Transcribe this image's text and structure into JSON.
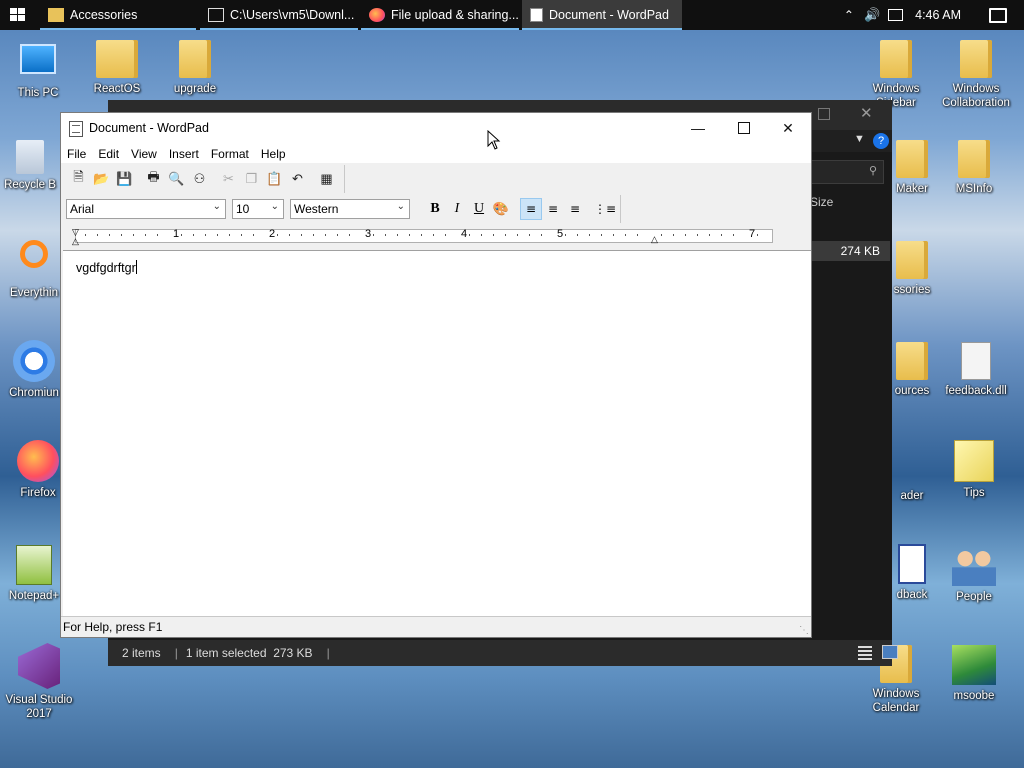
{
  "taskbar": {
    "tasks": [
      {
        "label": "Accessories"
      },
      {
        "label": "C:\\Users\\vm5\\Downl..."
      },
      {
        "label": "File upload & sharing..."
      },
      {
        "label": "Document - WordPad"
      }
    ],
    "clock": "4:46 AM"
  },
  "desktop": {
    "left_icons": [
      "This PC",
      "ReactOS",
      "upgrade",
      "Recycle B",
      "Everythin",
      "Chromiun",
      "Firefox",
      "Notepad+",
      "Visual Studio 2017"
    ],
    "right_icons": [
      "Windows Sidebar",
      "Windows Collaboration",
      "Maker",
      "MSInfo",
      "ssories",
      "feedback.dll",
      "ources",
      "ader",
      "Tips",
      "dback",
      "People",
      "Windows Calendar",
      "msoobe"
    ]
  },
  "explorer": {
    "size_header": "Size",
    "size_value": "274 KB",
    "status_items": "2 items",
    "status_selected": "1 item selected  273 KB",
    "help_glyph": "?"
  },
  "wordpad": {
    "title": "Document - WordPad",
    "menu": [
      "File",
      "Edit",
      "View",
      "Insert",
      "Format",
      "Help"
    ],
    "font": "Arial",
    "size": "10",
    "script": "Western",
    "bold": "B",
    "italic": "I",
    "underline": "U",
    "ruler_numbers": [
      "1",
      "2",
      "3",
      "4",
      "5",
      "7"
    ],
    "text": "vgdfgdrftgr",
    "status": "For Help, press F1"
  },
  "colors": {
    "taskbar_bg": "#101010",
    "accent": "#76b9ed",
    "selection": "#cce4f7"
  }
}
